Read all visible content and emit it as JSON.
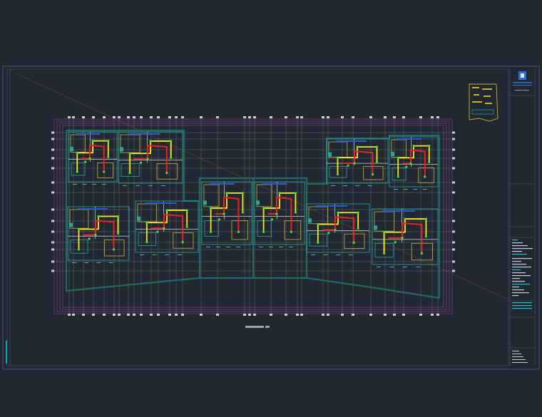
{
  "title_block": {
    "logo_icon": "building-logo-icon",
    "logo_color": "#2b6fd6",
    "accent_color": "#19c6c6",
    "text_lines": [
      "",
      "",
      ""
    ]
  },
  "drawing": {
    "background": "#222831",
    "scale_label": "",
    "pipe_supply_color": "#f5ea1c",
    "pipe_return_color": "#ee2020",
    "node_color": "#39e639",
    "wall_color": "#2aa59a",
    "boundary_color": "#7a3b7a"
  },
  "key_plan": {
    "icon": "key-plan-icon",
    "color": "#c9b22e"
  }
}
